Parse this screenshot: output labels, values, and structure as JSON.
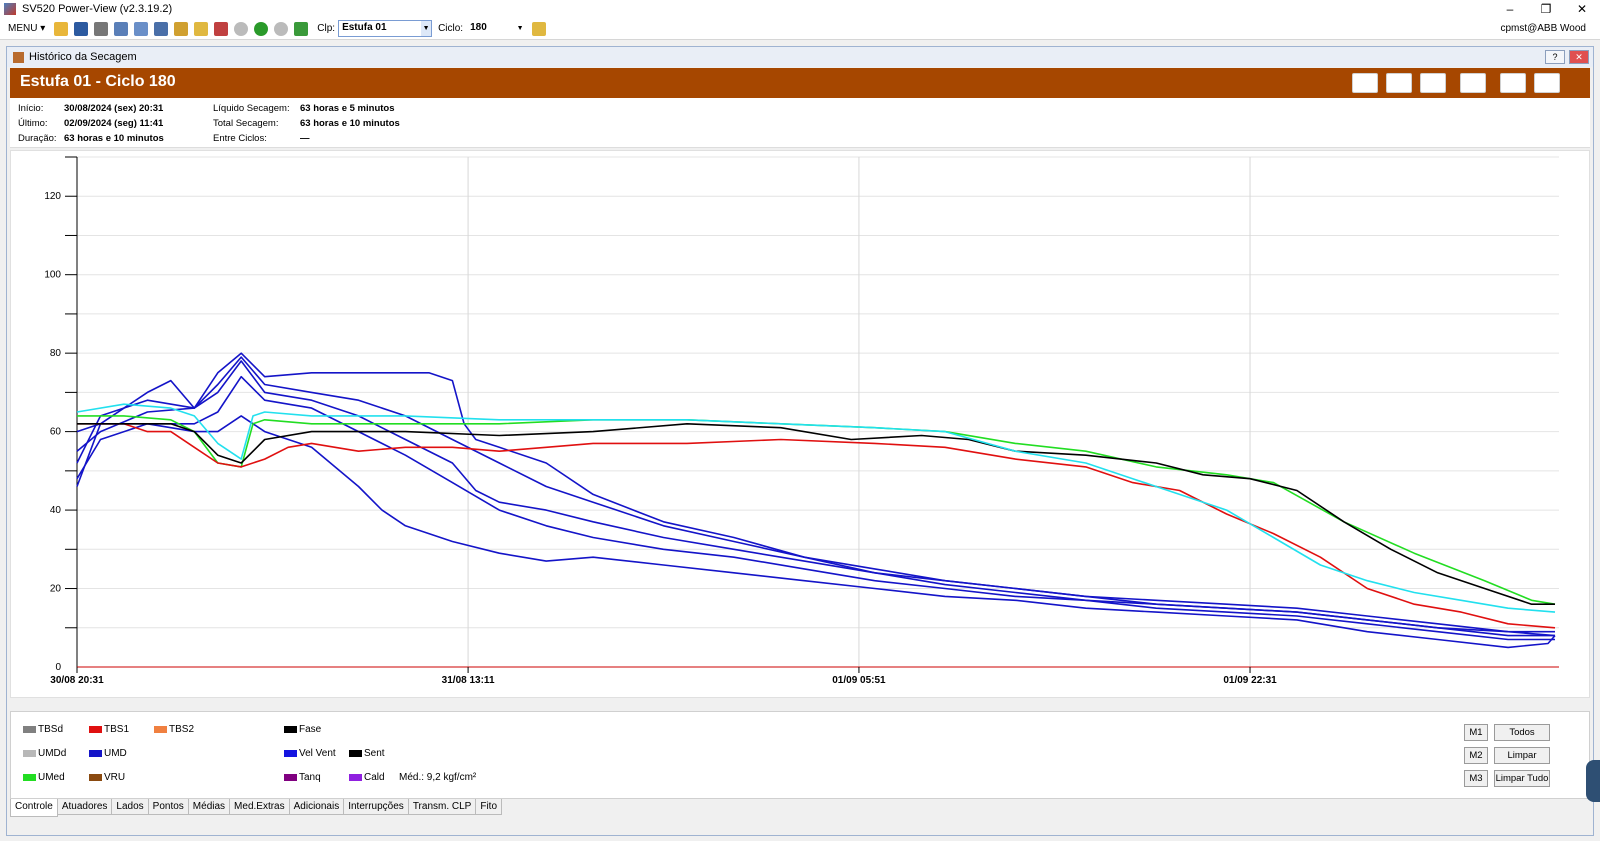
{
  "window": {
    "title": "SV520 Power-View (v2.3.19.2)"
  },
  "toolbar": {
    "menu_label": "MENU",
    "clp_label": "Clp:",
    "clp_value": "Estufa 01",
    "ciclo_label": "Ciclo:",
    "ciclo_value": "180",
    "user": "cpmst@ABB Wood"
  },
  "subwindow": {
    "title": "Histórico da Secagem"
  },
  "banner": {
    "title": "Estufa 01 - Ciclo 180"
  },
  "info": {
    "inicio_label": "Início:",
    "inicio_value": "30/08/2024 (sex) 20:31",
    "ultimo_label": "Último:",
    "ultimo_value": "02/09/2024 (seg) 11:41",
    "duracao_label": "Duração:",
    "duracao_value": "63 horas e 10 minutos",
    "liquido_label": "Líquido Secagem:",
    "liquido_value": "63 horas e 5 minutos",
    "total_label": "Total Secagem:",
    "total_value": "63 horas e 10 minutos",
    "entre_label": "Entre Ciclos:",
    "entre_value": "—"
  },
  "chart_data": {
    "type": "line",
    "ylim": [
      0,
      130
    ],
    "yticks": [
      0,
      20,
      40,
      60,
      80,
      100,
      120
    ],
    "x_hours_total": 63.17,
    "xticks": [
      {
        "label": "30/08 20:31",
        "hour": 0
      },
      {
        "label": "31/08 13:11",
        "hour": 16.67
      },
      {
        "label": "01/09 05:51",
        "hour": 33.33
      },
      {
        "label": "01/09 22:31",
        "hour": 50.0
      }
    ],
    "series": [
      {
        "name": "UMD",
        "color": "#1414c8",
        "points": [
          [
            0,
            46
          ],
          [
            1,
            62
          ],
          [
            3,
            70
          ],
          [
            4,
            73
          ],
          [
            5,
            66
          ],
          [
            6,
            75
          ],
          [
            7,
            80
          ],
          [
            8,
            74
          ],
          [
            10,
            75
          ],
          [
            12,
            75
          ],
          [
            15,
            75
          ],
          [
            16,
            73
          ],
          [
            16.5,
            62
          ],
          [
            17,
            58
          ],
          [
            18,
            56
          ],
          [
            20,
            52
          ],
          [
            22,
            44
          ],
          [
            25,
            37
          ],
          [
            28,
            33
          ],
          [
            31,
            28
          ],
          [
            34,
            25
          ],
          [
            37,
            22
          ],
          [
            40,
            20
          ],
          [
            43,
            18
          ],
          [
            46,
            17
          ],
          [
            49,
            16
          ],
          [
            52,
            15
          ],
          [
            55,
            13
          ],
          [
            58,
            11
          ],
          [
            61,
            9
          ],
          [
            63,
            8
          ]
        ]
      },
      {
        "name": "UMD",
        "color": "#1414c8",
        "points": [
          [
            0,
            52
          ],
          [
            1,
            64
          ],
          [
            3,
            68
          ],
          [
            5,
            66
          ],
          [
            6,
            72
          ],
          [
            7,
            79
          ],
          [
            8,
            72
          ],
          [
            10,
            70
          ],
          [
            12,
            68
          ],
          [
            14,
            64
          ],
          [
            16,
            58
          ],
          [
            18,
            52
          ],
          [
            20,
            46
          ],
          [
            22,
            42
          ],
          [
            25,
            36
          ],
          [
            28,
            32
          ],
          [
            31,
            28
          ],
          [
            34,
            24
          ],
          [
            37,
            22
          ],
          [
            40,
            20
          ],
          [
            43,
            18
          ],
          [
            46,
            16
          ],
          [
            49,
            15
          ],
          [
            52,
            14
          ],
          [
            55,
            12
          ],
          [
            58,
            10
          ],
          [
            61,
            9
          ],
          [
            63,
            9
          ]
        ]
      },
      {
        "name": "UMD",
        "color": "#1414c8",
        "points": [
          [
            0,
            55
          ],
          [
            1,
            60
          ],
          [
            3,
            65
          ],
          [
            5,
            66
          ],
          [
            6,
            70
          ],
          [
            7,
            78
          ],
          [
            8,
            70
          ],
          [
            10,
            68
          ],
          [
            12,
            64
          ],
          [
            14,
            58
          ],
          [
            16,
            52
          ],
          [
            17,
            45
          ],
          [
            18,
            42
          ],
          [
            20,
            40
          ],
          [
            22,
            37
          ],
          [
            25,
            33
          ],
          [
            28,
            30
          ],
          [
            31,
            27
          ],
          [
            34,
            24
          ],
          [
            37,
            21
          ],
          [
            40,
            19
          ],
          [
            43,
            17
          ],
          [
            46,
            16
          ],
          [
            49,
            15
          ],
          [
            52,
            14
          ],
          [
            55,
            12
          ],
          [
            58,
            10
          ],
          [
            61,
            8
          ],
          [
            63,
            8
          ]
        ]
      },
      {
        "name": "UMD",
        "color": "#1414c8",
        "points": [
          [
            0,
            60
          ],
          [
            1,
            62
          ],
          [
            3,
            62
          ],
          [
            5,
            62
          ],
          [
            6,
            65
          ],
          [
            7,
            74
          ],
          [
            8,
            68
          ],
          [
            10,
            66
          ],
          [
            12,
            60
          ],
          [
            14,
            54
          ],
          [
            16,
            47
          ],
          [
            18,
            40
          ],
          [
            20,
            36
          ],
          [
            22,
            33
          ],
          [
            25,
            30
          ],
          [
            28,
            28
          ],
          [
            31,
            25
          ],
          [
            34,
            22
          ],
          [
            37,
            20
          ],
          [
            40,
            18
          ],
          [
            43,
            17
          ],
          [
            46,
            15
          ],
          [
            49,
            14
          ],
          [
            52,
            13
          ],
          [
            55,
            11
          ],
          [
            58,
            9
          ],
          [
            61,
            7
          ],
          [
            63,
            7
          ]
        ]
      },
      {
        "name": "UMD",
        "color": "#1414c8",
        "points": [
          [
            0,
            48
          ],
          [
            1,
            58
          ],
          [
            3,
            62
          ],
          [
            5,
            60
          ],
          [
            6,
            60
          ],
          [
            7,
            64
          ],
          [
            8,
            60
          ],
          [
            10,
            56
          ],
          [
            12,
            46
          ],
          [
            13,
            40
          ],
          [
            14,
            36
          ],
          [
            16,
            32
          ],
          [
            18,
            29
          ],
          [
            20,
            27
          ],
          [
            22,
            28
          ],
          [
            25,
            26
          ],
          [
            28,
            24
          ],
          [
            31,
            22
          ],
          [
            34,
            20
          ],
          [
            37,
            18
          ],
          [
            40,
            17
          ],
          [
            43,
            15
          ],
          [
            46,
            14
          ],
          [
            49,
            13
          ],
          [
            52,
            12
          ],
          [
            55,
            9
          ],
          [
            58,
            7
          ],
          [
            61,
            5
          ],
          [
            62.7,
            6
          ],
          [
            63,
            8
          ]
        ]
      },
      {
        "name": "UMed",
        "color": "#22dd22",
        "points": [
          [
            0,
            64
          ],
          [
            2,
            64
          ],
          [
            4,
            63
          ],
          [
            5,
            60
          ],
          [
            6,
            52
          ],
          [
            7,
            51
          ],
          [
            7.5,
            62
          ],
          [
            8,
            63
          ],
          [
            10,
            62
          ],
          [
            14,
            62
          ],
          [
            18,
            62
          ],
          [
            22,
            63
          ],
          [
            26,
            63
          ],
          [
            30,
            62
          ],
          [
            34,
            61
          ],
          [
            37,
            60
          ],
          [
            40,
            57
          ],
          [
            43,
            55
          ],
          [
            46,
            51
          ],
          [
            49,
            49
          ],
          [
            51,
            47
          ],
          [
            54,
            37
          ],
          [
            57,
            29
          ],
          [
            60,
            22
          ],
          [
            62,
            17
          ],
          [
            63,
            16
          ]
        ]
      },
      {
        "name": "TBS1",
        "color": "#e01010",
        "points": [
          [
            0,
            62
          ],
          [
            2,
            62
          ],
          [
            3,
            60
          ],
          [
            4,
            60
          ],
          [
            5,
            56
          ],
          [
            6,
            52
          ],
          [
            7,
            51
          ],
          [
            8,
            53
          ],
          [
            9,
            56
          ],
          [
            10,
            57
          ],
          [
            12,
            55
          ],
          [
            14,
            56
          ],
          [
            16,
            56
          ],
          [
            18,
            55
          ],
          [
            20,
            56
          ],
          [
            22,
            57
          ],
          [
            26,
            57
          ],
          [
            30,
            58
          ],
          [
            34,
            57
          ],
          [
            37,
            56
          ],
          [
            40,
            53
          ],
          [
            43,
            51
          ],
          [
            45,
            47
          ],
          [
            47,
            45
          ],
          [
            49,
            39
          ],
          [
            51,
            34
          ],
          [
            53,
            28
          ],
          [
            55,
            20
          ],
          [
            57,
            16
          ],
          [
            59,
            14
          ],
          [
            61,
            11
          ],
          [
            63,
            10
          ]
        ]
      },
      {
        "name": "Sent",
        "color": "#000000",
        "points": [
          [
            0,
            62
          ],
          [
            2,
            62
          ],
          [
            4,
            62
          ],
          [
            5,
            60
          ],
          [
            6,
            54
          ],
          [
            7,
            52
          ],
          [
            8,
            58
          ],
          [
            10,
            60
          ],
          [
            14,
            60
          ],
          [
            18,
            59
          ],
          [
            22,
            60
          ],
          [
            26,
            62
          ],
          [
            30,
            61
          ],
          [
            33,
            58
          ],
          [
            36,
            59
          ],
          [
            38,
            58
          ],
          [
            40,
            55
          ],
          [
            43,
            54
          ],
          [
            46,
            52
          ],
          [
            48,
            49
          ],
          [
            50,
            48
          ],
          [
            52,
            45
          ],
          [
            54,
            37
          ],
          [
            56,
            30
          ],
          [
            58,
            24
          ],
          [
            60,
            20
          ],
          [
            62,
            16
          ],
          [
            63,
            16
          ]
        ]
      },
      {
        "name": "Vel Vent",
        "color": "#22e0ee",
        "points": [
          [
            0,
            65
          ],
          [
            2,
            67
          ],
          [
            4,
            66
          ],
          [
            5,
            64
          ],
          [
            6,
            57
          ],
          [
            7,
            53
          ],
          [
            7.5,
            64
          ],
          [
            8,
            65
          ],
          [
            10,
            64
          ],
          [
            14,
            64
          ],
          [
            18,
            63
          ],
          [
            22,
            63
          ],
          [
            26,
            63
          ],
          [
            30,
            62
          ],
          [
            34,
            61
          ],
          [
            37,
            60
          ],
          [
            40,
            55
          ],
          [
            43,
            52
          ],
          [
            45,
            48
          ],
          [
            47,
            44
          ],
          [
            49,
            40
          ],
          [
            51,
            33
          ],
          [
            53,
            26
          ],
          [
            55,
            22
          ],
          [
            57,
            19
          ],
          [
            59,
            17
          ],
          [
            61,
            15
          ],
          [
            63,
            14
          ]
        ]
      }
    ]
  },
  "legend": {
    "items": [
      {
        "label": "TBSd",
        "color": "#808080"
      },
      {
        "label": "TBS1",
        "color": "#e01010"
      },
      {
        "label": "TBS2",
        "color": "#f08040"
      },
      {
        "label": "Fase",
        "color": "#000000"
      },
      {
        "label": "UMDd",
        "color": "#b8b8b8"
      },
      {
        "label": "UMD",
        "color": "#1414c8"
      },
      {
        "label": "Vel Vent",
        "color": "#1414e0"
      },
      {
        "label": "Sent",
        "color": "#000000"
      },
      {
        "label": "UMed",
        "color": "#22dd22"
      },
      {
        "label": "VRU",
        "color": "#8a4a10"
      },
      {
        "label": "Tanq",
        "color": "#800080"
      },
      {
        "label": "Cald",
        "color": "#9020e0"
      }
    ],
    "note": "Méd.: 9,2 kgf/cm²"
  },
  "buttons": {
    "m1": "M1",
    "m2": "M2",
    "m3": "M3",
    "todos": "Todos",
    "limpar": "Limpar",
    "limpar_tudo": "Limpar Tudo"
  },
  "tabs": [
    "Controle",
    "Atuadores",
    "Lados",
    "Pontos",
    "Médias",
    "Med.Extras",
    "Adicionais",
    "Interrupções",
    "Transm. CLP",
    "Fito"
  ]
}
